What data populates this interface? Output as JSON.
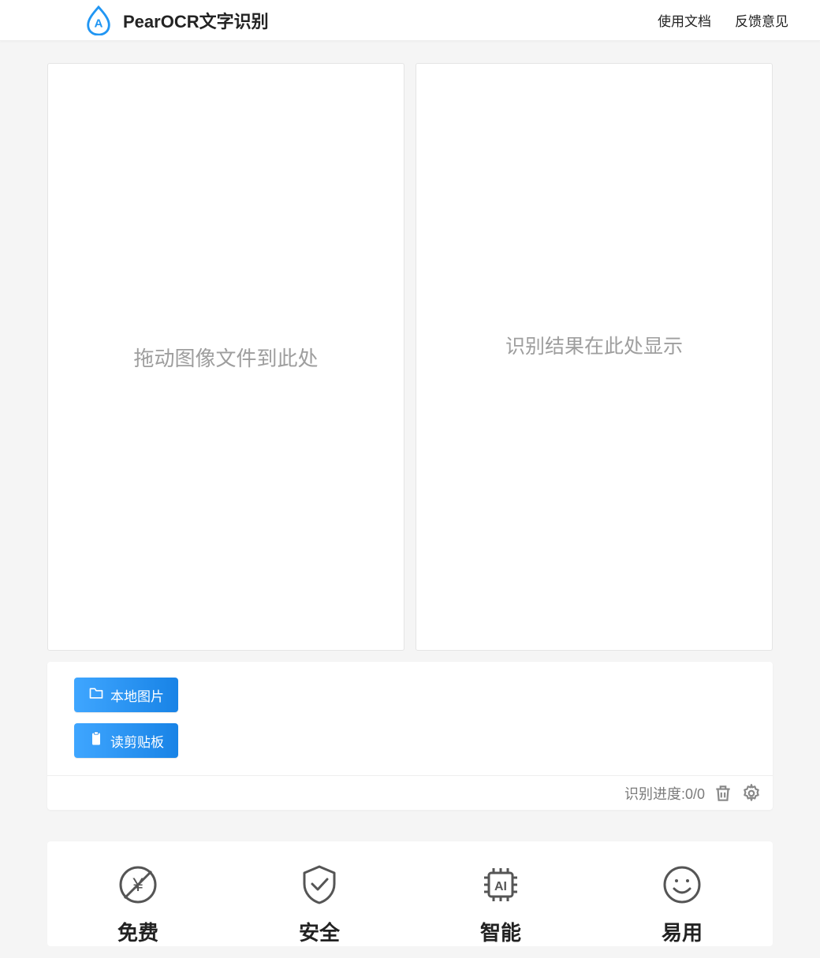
{
  "header": {
    "title": "PearOCR文字识别",
    "nav": {
      "docs": "使用文档",
      "feedback": "反馈意见"
    }
  },
  "panels": {
    "drop_placeholder": "拖动图像文件到此处",
    "result_placeholder": "识别结果在此处显示"
  },
  "actions": {
    "local_image": "本地图片",
    "read_clipboard": "读剪贴板",
    "progress_label": "识别进度:0/0"
  },
  "features": [
    {
      "title": "免费",
      "icon": "free-icon"
    },
    {
      "title": "安全",
      "icon": "shield-icon"
    },
    {
      "title": "智能",
      "icon": "ai-icon"
    },
    {
      "title": "易用",
      "icon": "smile-icon"
    }
  ]
}
